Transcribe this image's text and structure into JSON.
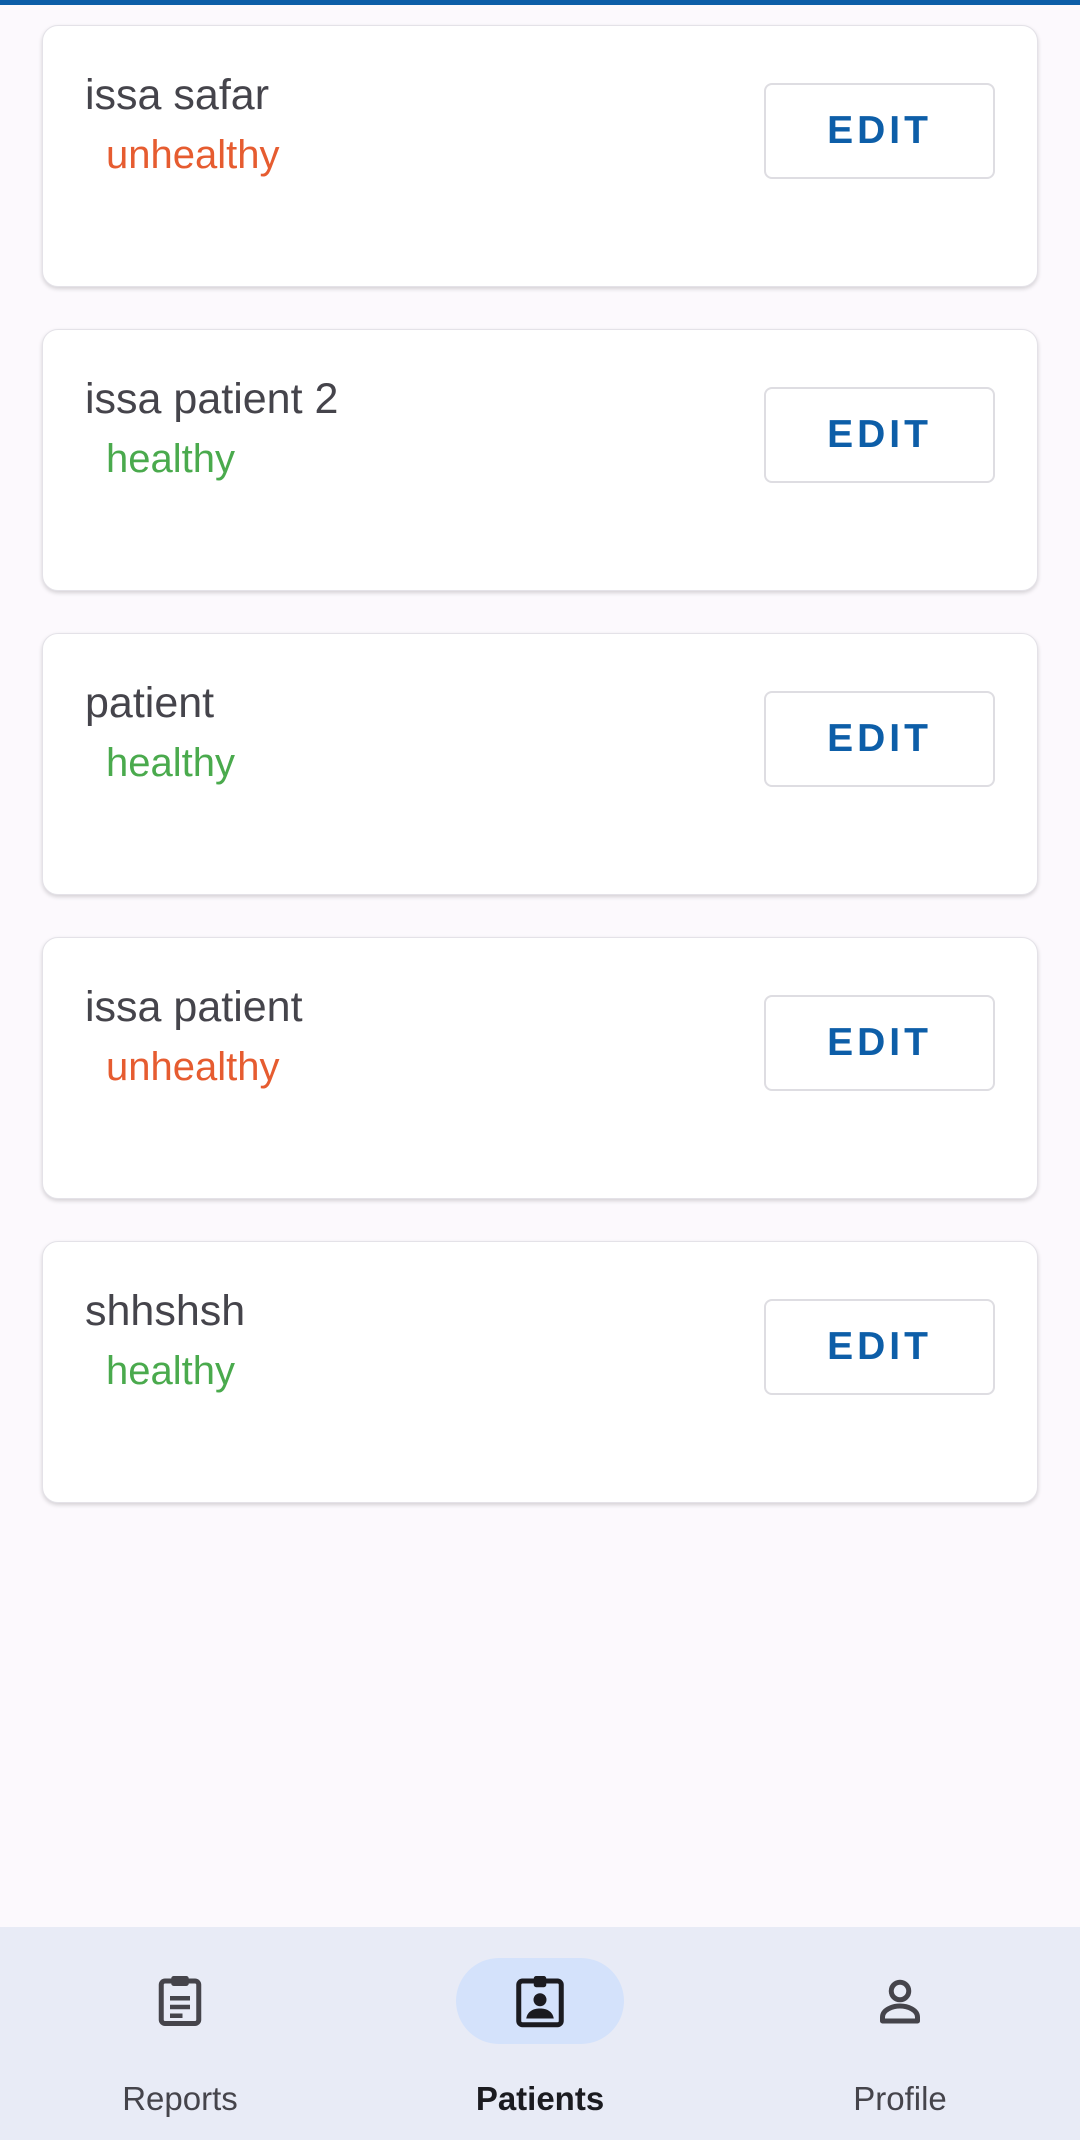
{
  "patients": [
    {
      "name": "issa safar",
      "status": "unhealthy",
      "edit_label": "EDIT"
    },
    {
      "name": "issa patient 2",
      "status": "healthy",
      "edit_label": "EDIT"
    },
    {
      "name": "patient",
      "status": "healthy",
      "edit_label": "EDIT"
    },
    {
      "name": "issa patient",
      "status": "unhealthy",
      "edit_label": "EDIT"
    },
    {
      "name": "shhshsh",
      "status": "healthy",
      "edit_label": "EDIT"
    }
  ],
  "bottom_nav": {
    "items": [
      {
        "label": "Reports",
        "icon": "clipboard-list-icon",
        "active": false
      },
      {
        "label": "Patients",
        "icon": "badge-person-icon",
        "active": true
      },
      {
        "label": "Profile",
        "icon": "person-icon",
        "active": false
      }
    ]
  },
  "colors": {
    "accent": "#0d5ea8",
    "healthy": "#4aaa4d",
    "unhealthy": "#e65c30",
    "background": "#fcf9fd",
    "nav_background": "#e8ebf6",
    "nav_active_pill": "#d4e2fb"
  }
}
